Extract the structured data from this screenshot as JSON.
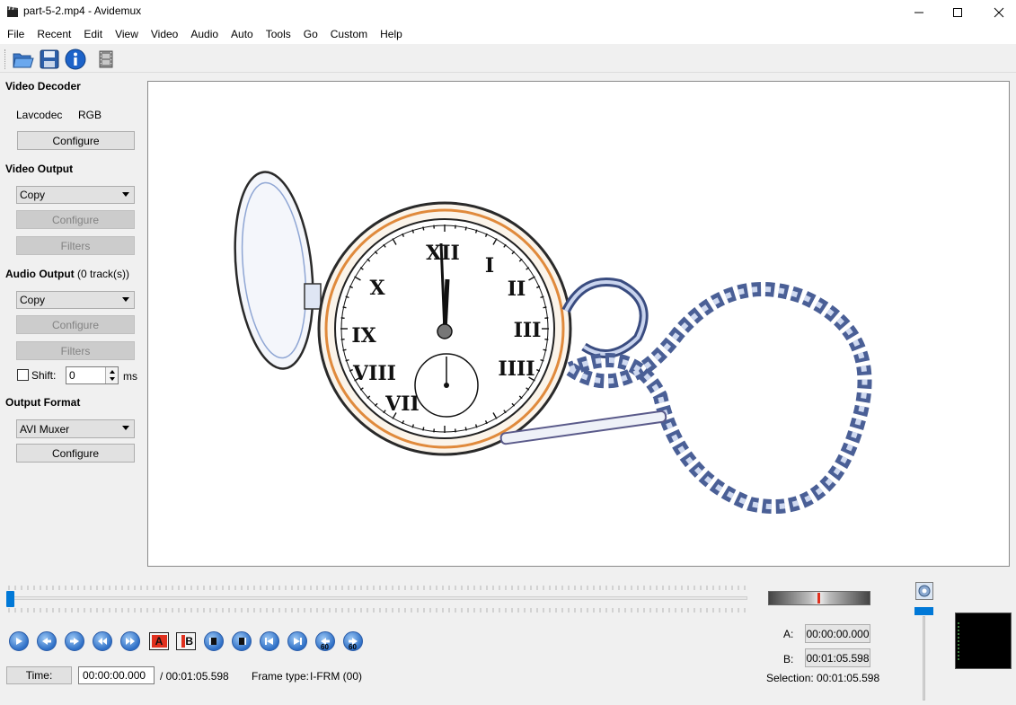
{
  "window": {
    "title": "part-5-2.mp4 - Avidemux",
    "minimize": "—",
    "maximize": "☐",
    "close": "✕"
  },
  "menu": [
    "File",
    "Recent",
    "Edit",
    "View",
    "Video",
    "Audio",
    "Auto",
    "Tools",
    "Go",
    "Custom",
    "Help"
  ],
  "toolbar": {
    "icons": [
      "open-folder-icon",
      "save-disk-icon",
      "info-icon",
      "film-strip-icon"
    ]
  },
  "video_decoder": {
    "label": "Video Decoder",
    "codec": "Lavcodec",
    "colorspace": "RGB",
    "configure": "Configure"
  },
  "video_output": {
    "label": "Video Output",
    "selected": "Copy",
    "configure": "Configure",
    "filters": "Filters"
  },
  "audio_output": {
    "label": "Audio Output",
    "tracks": "(0 track(s))",
    "selected": "Copy",
    "configure": "Configure",
    "filters": "Filters",
    "shift_label": "Shift:",
    "shift_value": "0",
    "shift_unit": "ms"
  },
  "output_format": {
    "label": "Output Format",
    "selected": "AVI Muxer",
    "configure": "Configure"
  },
  "timeline": {
    "position": 0.0,
    "time_button": "Time:",
    "current_time": "00:00:00.000",
    "total_time": "/ 00:01:05.598",
    "frame_type_label": "Frame type:",
    "frame_type": "I-FRM (00)"
  },
  "markers": {
    "a_label": "A:",
    "a_value": "00:00:00.000",
    "b_label": "B:",
    "b_value": "00:01:05.598",
    "selection_label": "Selection:",
    "selection_value": "00:01:05.598",
    "marker_a_text": "A",
    "marker_b_text": "B"
  },
  "controls": {
    "icons": [
      "play-icon",
      "previous-frame-icon",
      "next-frame-icon",
      "previous-keyframe-icon",
      "next-keyframe-icon",
      "set-marker-a-icon",
      "set-marker-b-icon",
      "previous-black-frame-icon",
      "next-black-frame-icon",
      "goto-first-frame-icon",
      "goto-last-frame-icon",
      "back-60-icon",
      "forward-60-icon"
    ],
    "seek_back_text": "60",
    "seek_fwd_text": "60"
  },
  "colors": {
    "accent": "#0078d7",
    "marker_red": "#e0301e"
  }
}
